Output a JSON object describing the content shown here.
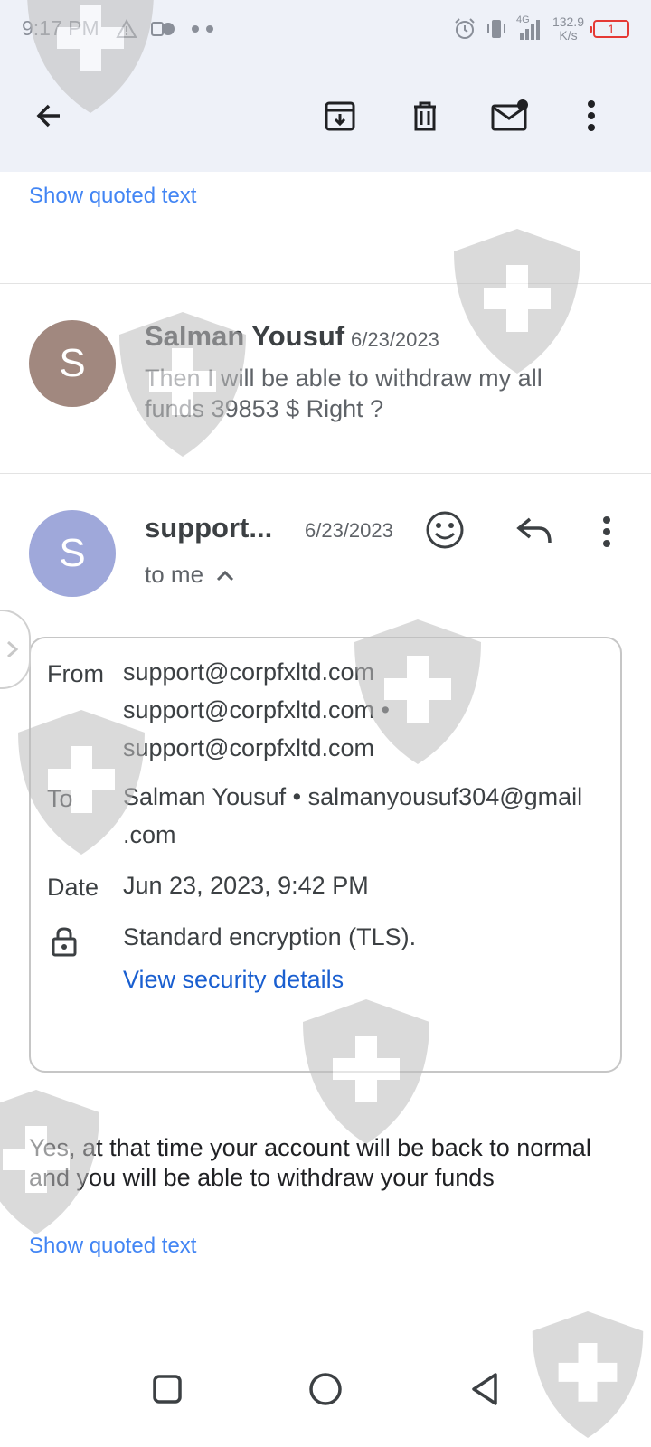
{
  "status_bar": {
    "time": "9:17 PM",
    "network_speed_value": "132.9",
    "network_speed_unit": "K/s",
    "network_type": "4G",
    "battery_level": "1",
    "icons": [
      "warning-icon",
      "app-notification-icon",
      "alarm-icon",
      "vibrate-icon",
      "signal-icon",
      "battery-icon"
    ]
  },
  "toolbar": {
    "icons": [
      "back-arrow-icon",
      "archive-icon",
      "delete-icon",
      "mark-unread-icon",
      "more-vert-icon"
    ]
  },
  "thread": {
    "show_quoted_top": "Show quoted text",
    "collapsed_message": {
      "avatar_letter": "S",
      "avatar_color": "#a1887f",
      "sender": "Salman Yousuf",
      "date": "6/23/2023",
      "snippet": "Then I will be able to withdraw my all funds 39853 $ Right ?"
    },
    "expanded_message": {
      "avatar_letter": "S",
      "avatar_color": "#9fa8da",
      "sender": "support...",
      "date": "6/23/2023",
      "recipient": "to me",
      "details": {
        "from_label": "From",
        "from_lines": [
          "support@corpfxltd.com",
          "support@corpfxltd.com •",
          "support@corpfxltd.com"
        ],
        "to_label": "To",
        "to_lines": [
          "Salman Yousuf • salmanyousuf304@gmail",
          ".com"
        ],
        "date_label": "Date",
        "date_value": "Jun 23, 2023, 9:42 PM",
        "security_text": "Standard encryption (TLS).",
        "security_link": "View security details"
      },
      "body": "Yes, at that time your account will be back to normal and you will be able to withdraw your funds",
      "show_quoted": "Show quoted text"
    }
  },
  "nav_bar": {
    "icons": [
      "recents-square-icon",
      "home-circle-icon",
      "back-triangle-icon"
    ]
  },
  "colors": {
    "top_background": "#eef1f8",
    "link": "#4285f4",
    "security_link": "#1a5fd0",
    "battery_low": "#e53935"
  }
}
